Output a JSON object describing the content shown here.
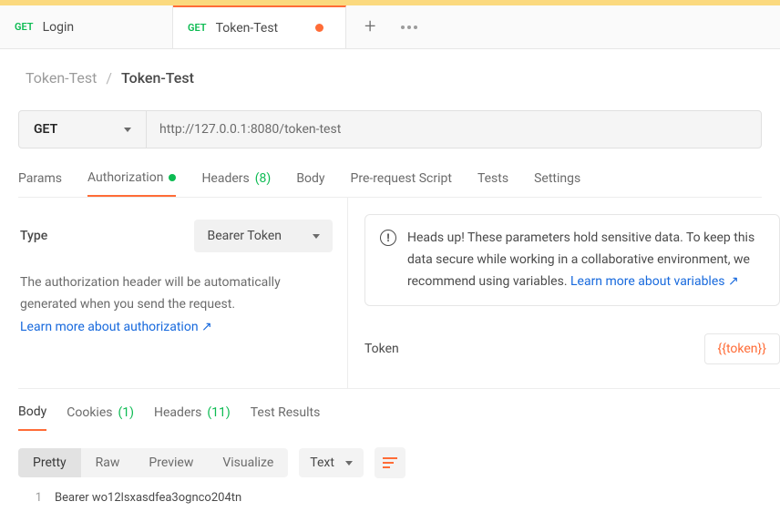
{
  "tabs": [
    {
      "method": "GET",
      "label": "Login",
      "modified": false,
      "active": false
    },
    {
      "method": "GET",
      "label": "Token-Test",
      "modified": true,
      "active": true
    }
  ],
  "breadcrumb": {
    "parent": "Token-Test",
    "current": "Token-Test"
  },
  "request": {
    "method": "GET",
    "url": "http://127.0.0.1:8080/token-test"
  },
  "req_tabs": {
    "params": "Params",
    "authorization": "Authorization",
    "headers": "Headers",
    "headers_count": "(8)",
    "body": "Body",
    "prerequest": "Pre-request Script",
    "tests": "Tests",
    "settings": "Settings"
  },
  "auth": {
    "type_label": "Type",
    "type_value": "Bearer Token",
    "desc": "The authorization header will be automatically generated when you send the request.",
    "desc_link": "Learn more about authorization",
    "token_label": "Token",
    "token_value": "{{token}}"
  },
  "warn": {
    "text": "Heads up! These parameters hold sensitive data. To keep this data secure while working in a collaborative environment, we recommend using variables.",
    "link": "Learn more about variables"
  },
  "resp_tabs": {
    "body": "Body",
    "cookies": "Cookies",
    "cookies_count": "(1)",
    "headers": "Headers",
    "headers_count": "(11)",
    "test_results": "Test Results"
  },
  "view_modes": {
    "pretty": "Pretty",
    "raw": "Raw",
    "preview": "Preview",
    "visualize": "Visualize"
  },
  "format": "Text",
  "response": {
    "line_no": "1",
    "body": "Bearer wo12lsxasdfea3ognco204tn"
  }
}
